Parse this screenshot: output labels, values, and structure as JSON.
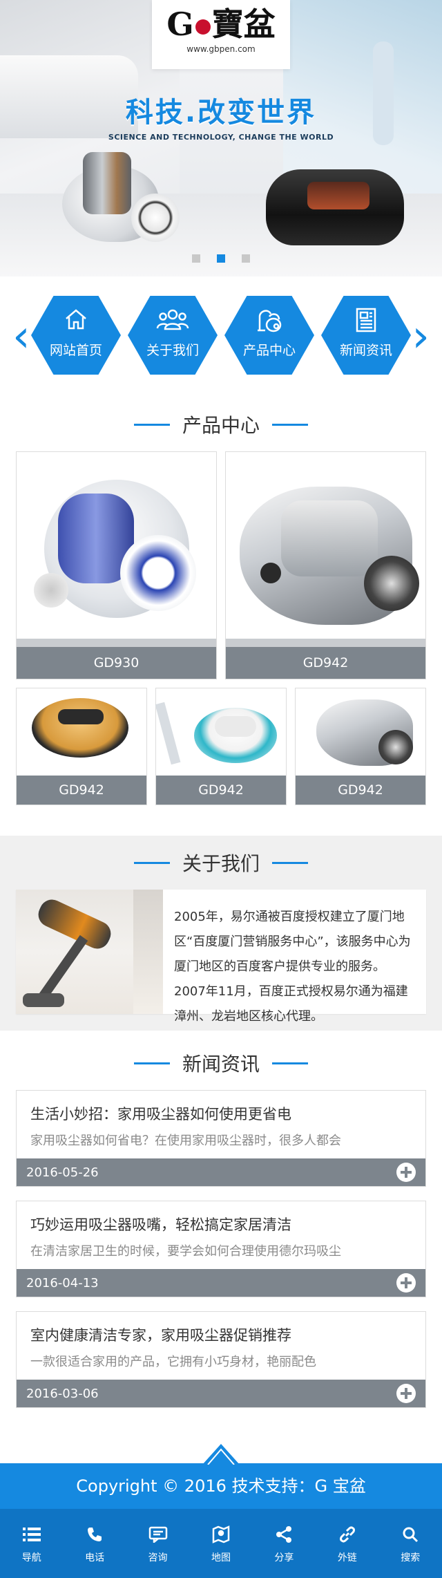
{
  "banner": {
    "logo_text": "G寶盆",
    "logo_url": "www.gbpen.com",
    "slogan_cn": "科技.改变世界",
    "slogan_en": "SCIENCE AND TECHNOLOGY, CHANGE THE WORLD",
    "slide_count": 3,
    "active_slide": 2
  },
  "hexnav": {
    "items": [
      {
        "label": "网站首页",
        "icon": "home-icon"
      },
      {
        "label": "关于我们",
        "icon": "people-icon"
      },
      {
        "label": "产品中心",
        "icon": "vacuum-icon"
      },
      {
        "label": "新闻资讯",
        "icon": "news-icon"
      }
    ]
  },
  "products": {
    "title": "产品中心",
    "items": [
      {
        "name": "GD930"
      },
      {
        "name": "GD942"
      },
      {
        "name": "GD942"
      },
      {
        "name": "GD942"
      },
      {
        "name": "GD942"
      }
    ]
  },
  "about": {
    "title": "关于我们",
    "text": "2005年，易尔通被百度授权建立了厦门地区“百度厦门营销服务中心”，该服务中心为厦门地区的百度客户提供专业的服务。2007年11月，百度正式授权易尔通为福建漳州、龙岩地区核心代理。"
  },
  "news": {
    "title": "新闻资讯",
    "items": [
      {
        "title": "生活小妙招：家用吸尘器如何使用更省电",
        "summary": "家用吸尘器如何省电？在使用家用吸尘器时，很多人都会",
        "date": "2016-05-26"
      },
      {
        "title": "巧妙运用吸尘器吸嘴，轻松搞定家居清洁",
        "summary": "在清洁家居卫生的时候，要学会如何合理使用德尔玛吸尘",
        "date": "2016-04-13"
      },
      {
        "title": "室内健康清洁专家，家用吸尘器促销推荐",
        "summary": "一款很适合家用的产品，它拥有小巧身材，艳丽配色",
        "date": "2016-03-06"
      }
    ]
  },
  "footer": {
    "copyright": "Copyright © 2016  技术支持：G 宝盆"
  },
  "bottom_nav": {
    "items": [
      {
        "label": "导航",
        "icon": "menu-icon"
      },
      {
        "label": "电话",
        "icon": "phone-icon"
      },
      {
        "label": "咨询",
        "icon": "chat-icon"
      },
      {
        "label": "地图",
        "icon": "map-icon"
      },
      {
        "label": "分享",
        "icon": "share-icon"
      },
      {
        "label": "外链",
        "icon": "link-icon"
      },
      {
        "label": "搜索",
        "icon": "search-icon"
      }
    ]
  },
  "colors": {
    "accent": "#1589e0",
    "bar_gray": "#7d858d",
    "bottom_nav": "#0f74c4"
  }
}
